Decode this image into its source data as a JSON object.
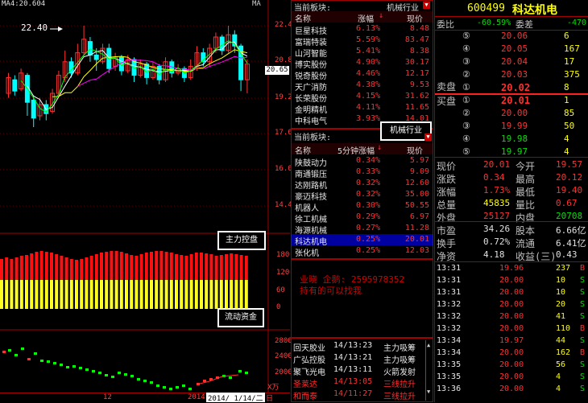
{
  "chart": {
    "ma_label": "MA4:20.604",
    "ma_tag": "MA",
    "price_ticks": [
      "22.4",
      "20.8",
      "19.2",
      "17.6",
      "16.0",
      "14.4"
    ],
    "current_price_tag": "20.65",
    "high_annotation": "22.40",
    "capital_ticks": [
      "180",
      "120",
      "60",
      "0"
    ],
    "volume_unit": "X万",
    "volume_ticks": [
      "2800",
      "2400",
      "2000"
    ],
    "date_label": "2014/ 1/14/二",
    "axis_left_label": "12",
    "axis_year_label": "2014",
    "period_label": "日",
    "main_force_label": "主力控盘",
    "flow_label": "流动资金",
    "capital_data": {
      "red_fraction": 0.62,
      "yellow_fraction": 0.38
    }
  },
  "sector": {
    "title": "当前板块:",
    "top_header": {
      "name": "名称",
      "change": "涨幅",
      "price": "现价"
    },
    "top_rows": [
      {
        "name": "巨星科技",
        "change": "6.13%",
        "price": "8.48"
      },
      {
        "name": "富瑞特装",
        "change": "5.59%",
        "price": "83.47"
      },
      {
        "name": "山河智能",
        "change": "5.41%",
        "price": "8.38"
      },
      {
        "name": "博实股份",
        "change": "4.90%",
        "price": "30.17"
      },
      {
        "name": "锐奇股份",
        "change": "4.46%",
        "price": "12.17"
      },
      {
        "name": "天广消防",
        "change": "4.38%",
        "price": "9.53"
      },
      {
        "name": "长荣股份",
        "change": "4.15%",
        "price": "31.62"
      },
      {
        "name": "金明精机",
        "change": "4.11%",
        "price": "11.65"
      },
      {
        "name": "中科电气",
        "change": "3.93%",
        "price": "14.01"
      }
    ],
    "bottom_title": "当前板块:",
    "bottom_sector": "机械行业",
    "bottom_header": {
      "name": "名称",
      "change": "5分钟涨幅",
      "price": "现价"
    },
    "bottom_rows": [
      {
        "name": "陕鼓动力",
        "change": "0.34%",
        "price": "5.97"
      },
      {
        "name": "南通锻压",
        "change": "0.33%",
        "price": "9.09"
      },
      {
        "name": "达刚路机",
        "change": "0.32%",
        "price": "12.60"
      },
      {
        "name": "豪迈科技",
        "change": "0.32%",
        "price": "35.00"
      },
      {
        "name": "机器人",
        "change": "0.30%",
        "price": "50.55"
      },
      {
        "name": "徐工机械",
        "change": "0.29%",
        "price": "6.97"
      },
      {
        "name": "海源机械",
        "change": "0.27%",
        "price": "11.28"
      },
      {
        "name": "科达机电",
        "change": "0.25%",
        "price": "20.01",
        "selected": true
      },
      {
        "name": "张化机",
        "change": "0.25%",
        "price": "12.03"
      }
    ]
  },
  "ad": {
    "line1": "业晓   企鹅: 2595978352",
    "line2": "持有的可以找我"
  },
  "news": [
    {
      "name": "回天胶业",
      "time": "14/13:23",
      "event": "主力吸筹"
    },
    {
      "name": "广弘控股",
      "time": "14/13:21",
      "event": "主力吸筹"
    },
    {
      "name": "聚飞光电",
      "time": "14/13:11",
      "event": "火箭发射"
    },
    {
      "name": "圣莱达",
      "time": "14/13:05",
      "event": "三线拉升"
    },
    {
      "name": "和而泰",
      "time": "14/11:27",
      "event": "三线拉升"
    }
  ],
  "quote": {
    "code": "600499",
    "name": "科达机电",
    "webi_label": "委比",
    "webi_value": "-60.59%",
    "weicha_label": "委差",
    "weicha_value": "-470",
    "sell_label": "卖盘",
    "buy_label": "买盘",
    "sells": [
      {
        "level": "⑤",
        "price": "20.06",
        "vol": "6"
      },
      {
        "level": "④",
        "price": "20.05",
        "vol": "167"
      },
      {
        "level": "③",
        "price": "20.04",
        "vol": "17"
      },
      {
        "level": "②",
        "price": "20.03",
        "vol": "375"
      },
      {
        "level": "①",
        "price": "20.02",
        "vol": "8"
      }
    ],
    "buys": [
      {
        "level": "①",
        "price": "20.01",
        "vol": "1"
      },
      {
        "level": "②",
        "price": "20.00",
        "vol": "85"
      },
      {
        "level": "③",
        "price": "19.99",
        "vol": "50"
      },
      {
        "level": "④",
        "price": "19.98",
        "vol": "4"
      },
      {
        "level": "⑤",
        "price": "19.97",
        "vol": "4"
      }
    ],
    "stats": [
      {
        "l1": "现价",
        "v1": "20.01",
        "l2": "今开",
        "v2": "19.57"
      },
      {
        "l1": "涨跌",
        "v1": "0.34",
        "l2": "最高",
        "v2": "20.12"
      },
      {
        "l1": "涨幅",
        "v1": "1.73%",
        "l2": "最低",
        "v2": "19.40"
      },
      {
        "l1": "总量",
        "v1": "45835",
        "l2": "量比",
        "v2": "0.67"
      },
      {
        "l1": "外盘",
        "v1": "25127",
        "l2": "内盘",
        "v2": "20708"
      }
    ],
    "stats2": [
      {
        "l1": "市盈",
        "v1": "34.26",
        "l2": "股本",
        "v2": "6.66亿"
      },
      {
        "l1": "换手",
        "v1": "0.72%",
        "l2": "流通",
        "v2": "6.41亿"
      },
      {
        "l1": "净资",
        "v1": "4.18",
        "l2": "收益(三)",
        "v2": "0.43"
      }
    ],
    "ticks": [
      {
        "time": "13:31",
        "price": "19.96",
        "vol": "237",
        "dir": "B"
      },
      {
        "time": "13:31",
        "price": "20.00",
        "vol": "10",
        "dir": "S"
      },
      {
        "time": "13:31",
        "price": "20.00",
        "vol": "10",
        "dir": "S"
      },
      {
        "time": "13:32",
        "price": "20.00",
        "vol": "20",
        "dir": "S"
      },
      {
        "time": "13:32",
        "price": "20.00",
        "vol": "41",
        "dir": "S"
      },
      {
        "time": "13:32",
        "price": "20.00",
        "vol": "110",
        "dir": "B"
      },
      {
        "time": "13:34",
        "price": "19.97",
        "vol": "44",
        "dir": "S"
      },
      {
        "time": "13:34",
        "price": "20.00",
        "vol": "162",
        "dir": "B"
      },
      {
        "time": "13:35",
        "price": "20.00",
        "vol": "56",
        "dir": "S"
      },
      {
        "time": "13:35",
        "price": "20.00",
        "vol": "4",
        "dir": "S"
      },
      {
        "time": "13:36",
        "price": "20.00",
        "vol": "4",
        "dir": "S"
      }
    ]
  },
  "colors": {
    "up": "#ff3030",
    "down": "#00e000",
    "panel_border": "#a00000",
    "selected_row": "#0000a0"
  }
}
